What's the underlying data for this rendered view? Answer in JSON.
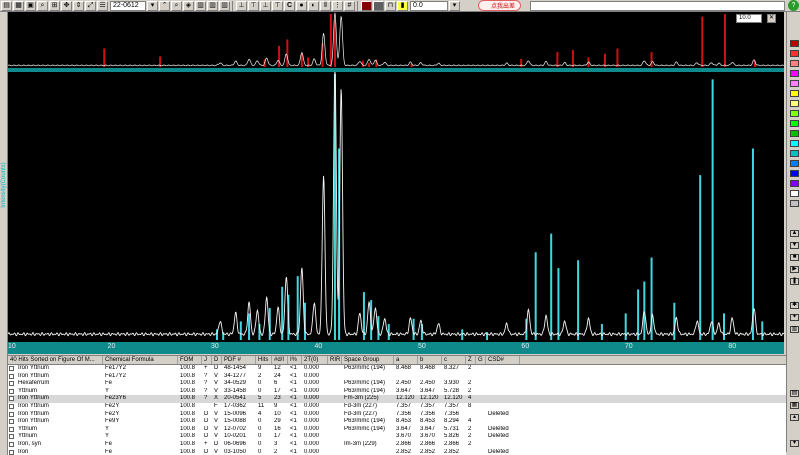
{
  "toolbar": {
    "pdf_number": "22-0612",
    "offset_value": "0.0",
    "callout_text": "点我出差",
    "zoom_value": "10.0",
    "help_label": "?"
  },
  "axes": {
    "ylabel": "Intensity(Counts)",
    "x_ticks": [
      "10",
      "20",
      "30",
      "40",
      "50",
      "60",
      "70",
      "80"
    ],
    "x_range": [
      10,
      85
    ]
  },
  "table": {
    "columns": [
      "40 Hits Sorted on Figure Of M...",
      "Chemical Formula",
      "FOM",
      "J",
      "D",
      "PDF #",
      "Hits",
      "#d/I",
      "I%",
      "2T(0)",
      "RIR",
      "Space Group",
      "a",
      "b",
      "c",
      "Z",
      "G",
      "CSD#"
    ],
    "rows": [
      [
        "Iron Yttrium",
        "Fe17Y2",
        "100.8",
        "+",
        "D",
        "48-1454",
        "9",
        "12",
        "<1",
        "0.000",
        "",
        "P63/mmc (194)",
        "8.468",
        "8.468",
        "8.327",
        "2",
        "",
        ""
      ],
      [
        "Iron Yttrium",
        "Fe17Y2",
        "100.8",
        "?",
        "V",
        "34-1277",
        "2",
        "24",
        "<1",
        "0.000",
        "",
        "",
        "",
        "",
        "",
        "",
        "",
        ""
      ],
      [
        "Hexaferrum",
        "Fe",
        "100.8",
        "?",
        "V",
        "34-0529",
        "0",
        "6",
        "<1",
        "0.000",
        "",
        "P63/mmc (194)",
        "2.450",
        "2.450",
        "3.930",
        "2",
        "",
        ""
      ],
      [
        "Yttrium",
        "Y",
        "100.8",
        "?",
        "V",
        "33-1458",
        "0",
        "17",
        "<1",
        "0.000",
        "",
        "P63/mmc (194)",
        "3.647",
        "3.647",
        "5.728",
        "2",
        "",
        ""
      ],
      [
        "Iron Yttrium",
        "Fe23Y6",
        "100.8",
        "?",
        "X",
        "20-0541",
        "5",
        "23",
        "<1",
        "0.000",
        "",
        "Fm-3m (225)",
        "12.120",
        "12.120",
        "12.120",
        "4",
        "",
        ""
      ],
      [
        "Iron Yttrium",
        "Fe2Y",
        "100.8",
        "",
        "F",
        "17-0362",
        "11",
        "9",
        "<1",
        "0.000",
        "",
        "Fd-3m (227)",
        "7.357",
        "7.357",
        "7.357",
        "8",
        "",
        ""
      ],
      [
        "Iron Yttrium",
        "Fe2Y",
        "100.8",
        "D",
        "V",
        "15-0096",
        "4",
        "10",
        "<1",
        "0.000",
        "",
        "Fd-3m (227)",
        "7.356",
        "7.356",
        "7.356",
        "",
        "",
        "Deleted"
      ],
      [
        "Iron Yttrium",
        "Fe9Y",
        "100.8",
        "D",
        "V",
        "15-0088",
        "0",
        "29",
        "<1",
        "0.000",
        "",
        "P63/mmc (194)",
        "8.453",
        "8.453",
        "8.294",
        "4",
        "",
        ""
      ],
      [
        "Yttrium",
        "Y",
        "100.8",
        "D",
        "V",
        "12-0702",
        "0",
        "16",
        "<1",
        "0.000",
        "",
        "P63/mmc (194)",
        "3.647",
        "3.647",
        "5.731",
        "2",
        "",
        "Deleted"
      ],
      [
        "Yttrium",
        "Y",
        "100.8",
        "D",
        "V",
        "10-0201",
        "0",
        "17",
        "<1",
        "0.000",
        "",
        "",
        "3.670",
        "3.670",
        "5.826",
        "2",
        "",
        "Deleted"
      ],
      [
        "Iron, syn",
        "Fe",
        "100.8",
        "+",
        "D",
        "06-0696",
        "0",
        "3",
        "<1",
        "0.000",
        "",
        "Im-3m (229)",
        "2.866",
        "2.866",
        "2.866",
        "2",
        "",
        ""
      ],
      [
        "Iron",
        "Fe",
        "100.8",
        "D",
        "V",
        "03-1050",
        "0",
        "2",
        "<1",
        "0.000",
        "",
        "",
        "2.852",
        "2.852",
        "2.852",
        "",
        "",
        "Deleted"
      ]
    ]
  },
  "chart_data": {
    "type": "line",
    "xlabel": "",
    "ylabel": "Intensity(Counts)",
    "xlim": [
      10,
      85
    ],
    "ylim": [
      0,
      100
    ],
    "pattern_peaks": [
      {
        "x": 30.5,
        "y": 5
      },
      {
        "x": 32.0,
        "y": 8
      },
      {
        "x": 33.3,
        "y": 12
      },
      {
        "x": 34.1,
        "y": 9
      },
      {
        "x": 35.0,
        "y": 14
      },
      {
        "x": 36.1,
        "y": 10
      },
      {
        "x": 36.9,
        "y": 22
      },
      {
        "x": 38.4,
        "y": 25
      },
      {
        "x": 39.6,
        "y": 12
      },
      {
        "x": 40.5,
        "y": 60
      },
      {
        "x": 41.6,
        "y": 100
      },
      {
        "x": 42.2,
        "y": 93
      },
      {
        "x": 44.0,
        "y": 8
      },
      {
        "x": 44.9,
        "y": 12
      },
      {
        "x": 45.5,
        "y": 10
      },
      {
        "x": 46.4,
        "y": 6
      },
      {
        "x": 48.9,
        "y": 6
      },
      {
        "x": 49.9,
        "y": 5
      },
      {
        "x": 51.6,
        "y": 4
      },
      {
        "x": 58.2,
        "y": 4
      },
      {
        "x": 60.3,
        "y": 9
      },
      {
        "x": 62.0,
        "y": 7
      },
      {
        "x": 63.8,
        "y": 5
      },
      {
        "x": 66.1,
        "y": 6
      },
      {
        "x": 71.5,
        "y": 9
      },
      {
        "x": 72.3,
        "y": 7
      },
      {
        "x": 74.6,
        "y": 6
      },
      {
        "x": 76.6,
        "y": 5
      },
      {
        "x": 78.0,
        "y": 5
      },
      {
        "x": 78.7,
        "y": 4
      },
      {
        "x": 80.0,
        "y": 6
      },
      {
        "x": 82.1,
        "y": 10
      }
    ],
    "reference_sticks": [
      {
        "x": 30.2,
        "y": 4
      },
      {
        "x": 30.8,
        "y": 3
      },
      {
        "x": 32.5,
        "y": 7
      },
      {
        "x": 33.3,
        "y": 10
      },
      {
        "x": 34.3,
        "y": 6
      },
      {
        "x": 35.3,
        "y": 12
      },
      {
        "x": 36.5,
        "y": 20
      },
      {
        "x": 37.1,
        "y": 17
      },
      {
        "x": 38.0,
        "y": 24
      },
      {
        "x": 38.7,
        "y": 14
      },
      {
        "x": 41.6,
        "y": 100
      },
      {
        "x": 42.0,
        "y": 72
      },
      {
        "x": 44.4,
        "y": 18
      },
      {
        "x": 45.1,
        "y": 15
      },
      {
        "x": 45.8,
        "y": 9
      },
      {
        "x": 46.8,
        "y": 6
      },
      {
        "x": 49.2,
        "y": 8
      },
      {
        "x": 50.0,
        "y": 6
      },
      {
        "x": 53.9,
        "y": 4
      },
      {
        "x": 56.3,
        "y": 3
      },
      {
        "x": 60.1,
        "y": 8
      },
      {
        "x": 61.0,
        "y": 33
      },
      {
        "x": 62.5,
        "y": 40
      },
      {
        "x": 63.2,
        "y": 27
      },
      {
        "x": 65.1,
        "y": 30
      },
      {
        "x": 67.4,
        "y": 6
      },
      {
        "x": 69.7,
        "y": 10
      },
      {
        "x": 70.9,
        "y": 19
      },
      {
        "x": 71.5,
        "y": 22
      },
      {
        "x": 72.2,
        "y": 31
      },
      {
        "x": 74.4,
        "y": 14
      },
      {
        "x": 76.9,
        "y": 62
      },
      {
        "x": 78.1,
        "y": 98
      },
      {
        "x": 79.2,
        "y": 10
      },
      {
        "x": 82.0,
        "y": 72
      },
      {
        "x": 82.9,
        "y": 7
      }
    ],
    "overview_red_sticks": [
      {
        "x": 19.3,
        "y": 35
      },
      {
        "x": 24.7,
        "y": 20
      },
      {
        "x": 34.8,
        "y": 14
      },
      {
        "x": 36.2,
        "y": 40
      },
      {
        "x": 37.0,
        "y": 52
      },
      {
        "x": 38.4,
        "y": 25
      },
      {
        "x": 39.0,
        "y": 18
      },
      {
        "x": 40.4,
        "y": 45
      },
      {
        "x": 41.2,
        "y": 100
      },
      {
        "x": 41.6,
        "y": 88
      },
      {
        "x": 44.3,
        "y": 12
      },
      {
        "x": 44.9,
        "y": 8
      },
      {
        "x": 45.6,
        "y": 14
      },
      {
        "x": 49.0,
        "y": 6
      },
      {
        "x": 59.6,
        "y": 15
      },
      {
        "x": 63.1,
        "y": 28
      },
      {
        "x": 64.6,
        "y": 32
      },
      {
        "x": 66.1,
        "y": 18
      },
      {
        "x": 67.7,
        "y": 25
      },
      {
        "x": 68.9,
        "y": 35
      },
      {
        "x": 72.2,
        "y": 28
      },
      {
        "x": 77.1,
        "y": 95
      },
      {
        "x": 79.3,
        "y": 100
      },
      {
        "x": 82.2,
        "y": 12
      }
    ]
  },
  "palette": {
    "colors": [
      "#c00000",
      "#ff3030",
      "#ff8080",
      "#ff00ff",
      "#ff80ff",
      "#ffff00",
      "#ffff80",
      "#80ff00",
      "#00ff00",
      "#00c000",
      "#00ffff",
      "#00c0c0",
      "#0080ff",
      "#0000ff",
      "#8000ff",
      "#ffffff",
      "#c0c0c0"
    ]
  }
}
